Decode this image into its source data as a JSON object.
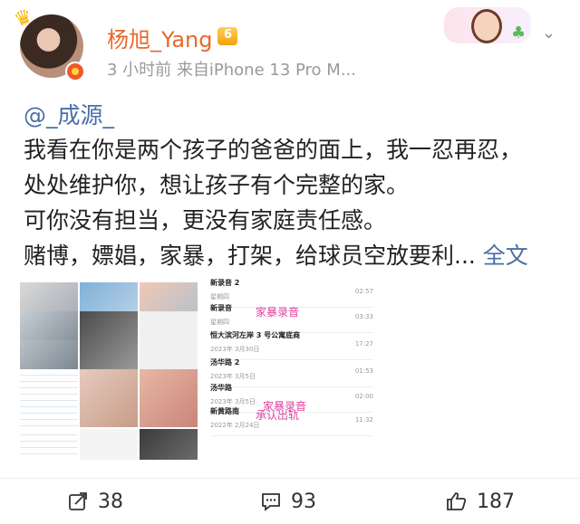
{
  "header": {
    "username": "杨旭_Yang",
    "meta": "3 小时前  来自iPhone 13 Pro M..."
  },
  "post": {
    "mention": "@_成源_",
    "lines": [
      "我看在你是两个孩子的爸爸的面上，我一忍再忍，",
      "处处维护你，想让孩子有个完整的家。",
      "可你没有担当，更没有家庭责任感。",
      "赌博，嫖娼，家暴，打架，给球员空放要利..."
    ],
    "full_text_link": "全文"
  },
  "doc_list": [
    {
      "title": "新录音 2",
      "date": "星期四",
      "time": "02:57",
      "tag": ""
    },
    {
      "title": "新录音",
      "date": "星期四",
      "time": "03:33",
      "tag": "家暴录音"
    },
    {
      "title": "恒大滨河左岸 3 号公寓底商",
      "date": "2023年 3月30日",
      "time": "17:27",
      "tag": ""
    },
    {
      "title": "汤华路 2",
      "date": "2023年 3月5日",
      "time": "01:53",
      "tag": ""
    },
    {
      "title": "汤华路",
      "date": "2023年 3月5日",
      "time": "02:00",
      "tag": "家暴录音"
    },
    {
      "title": "新黄路南",
      "date": "2022年 2月24日",
      "time": "11:32",
      "tag": "承认出轨"
    }
  ],
  "footer": {
    "repost_count": "38",
    "comment_count": "93",
    "like_count": "187"
  },
  "colors": {
    "username": "#e8692a",
    "link": "#4a6fa5",
    "tag": "#e040a0"
  }
}
